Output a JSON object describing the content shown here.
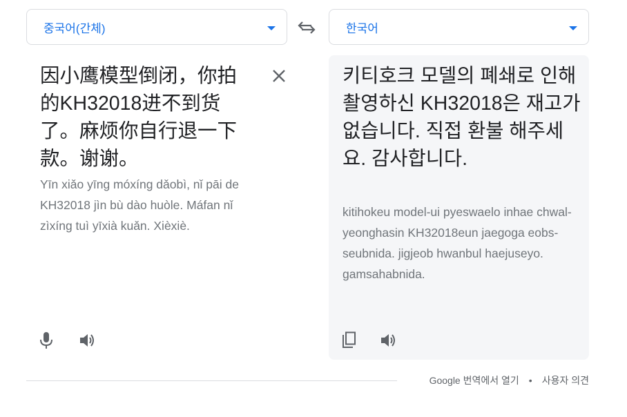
{
  "source": {
    "language": "중국어(간체)",
    "text": "因小鹰模型倒闭，你拍的KH32018进不到货了。麻烦你自行退一下款。谢谢。",
    "romanization": "Yīn xiǎo yīng móxíng dǎobì, nǐ pāi de KH32018 jìn bù dào huòle. Máfan nǐ zìxíng tuì yīxià kuǎn. Xièxiè."
  },
  "target": {
    "language": "한국어",
    "text": "키티호크 모델의 폐쇄로 인해 촬영하신 KH32018은 재고가 없습니다. 직접 환불 해주세요. 감사합니다.",
    "romanization": "kitihokeu model-ui pyeswaelo inhae chwal-yeonghasin KH32018eun jaegoga eobs-seubnida. jigjeob hwanbul haejuseyo. gamsahabnida."
  },
  "footer": {
    "open_link": "Google 번역에서 열기",
    "separator": "•",
    "feedback_link": "사용자 의견"
  },
  "colors": {
    "accent": "#1a73e8",
    "text": "#202124",
    "muted": "#70757a",
    "target_bg": "#f5f6f8",
    "icon": "#5f6368"
  }
}
